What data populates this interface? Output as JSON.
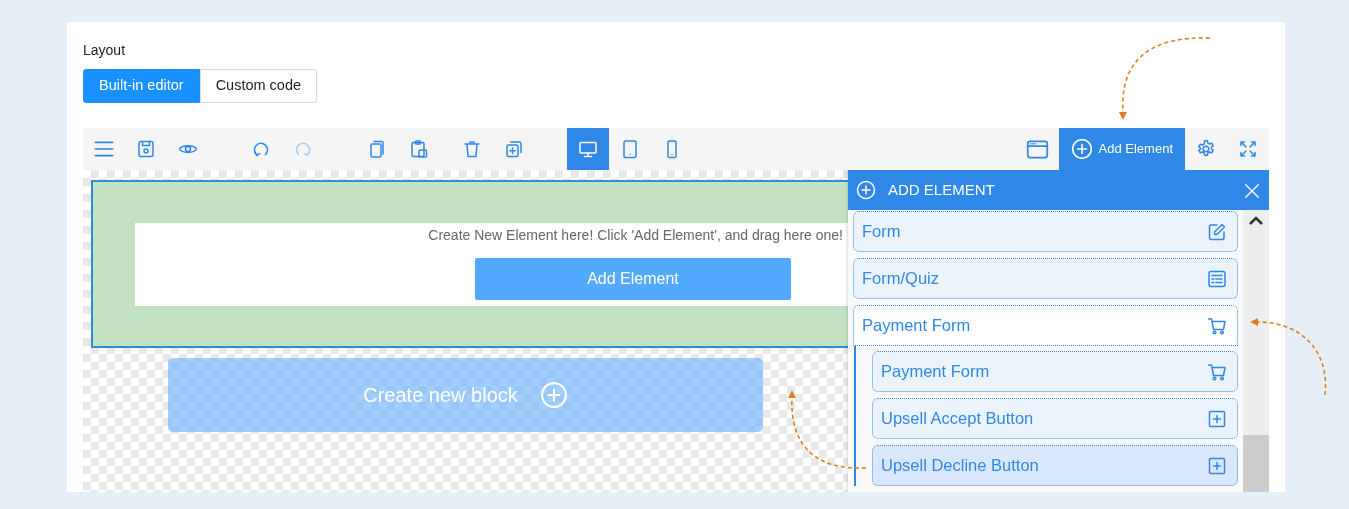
{
  "layout_label": "Layout",
  "layout_tabs": [
    {
      "label": "Built-in editor",
      "selected": true
    },
    {
      "label": "Custom code",
      "selected": false
    }
  ],
  "toolbar": {
    "history": [
      {
        "disabled": false
      },
      {
        "disabled": true
      }
    ],
    "devices": [
      {
        "selected": true
      },
      {
        "selected": false
      },
      {
        "selected": false
      }
    ],
    "add_element": "Add Element"
  },
  "canvas": {
    "hint": "Create New Element here! Click 'Add Element', and drag here one!",
    "button": "Add Element",
    "new_block": "Create new block"
  },
  "panel": {
    "title": "ADD ELEMENT",
    "items": [
      {
        "label": "Form",
        "kind": "edit",
        "expanded": false,
        "selected": false
      },
      {
        "label": "Form/Quiz",
        "kind": "quiz",
        "expanded": false,
        "selected": false
      },
      {
        "label": "Payment Form",
        "kind": "cart",
        "expanded": true,
        "selected": false,
        "children": [
          {
            "label": "Payment Form",
            "kind": "cart",
            "selected": false
          },
          {
            "label": "Upsell Accept Button",
            "kind": "plus",
            "selected": false
          },
          {
            "label": "Upsell Decline Button",
            "kind": "plus",
            "selected": true
          }
        ]
      }
    ]
  }
}
